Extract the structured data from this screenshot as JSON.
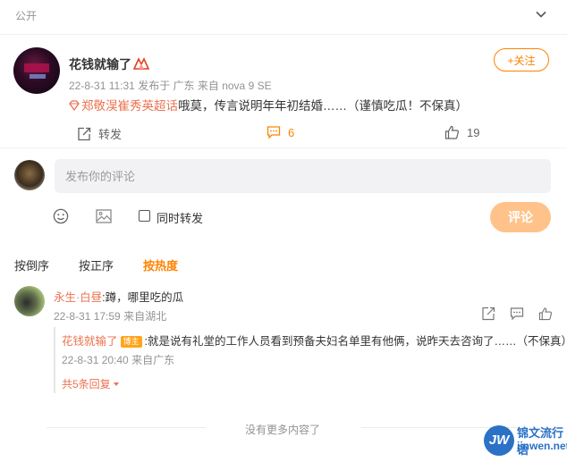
{
  "header": {
    "visibility": "公开"
  },
  "post": {
    "author": "花钱就输了",
    "time": "22-8-31 11:31",
    "location": "发布于 广东",
    "source": "来自 nova 9 SE",
    "follow_label": "+关注",
    "topic": "郑敬淏崔秀英超话",
    "body": "哦莫，传言说明年年初结婚……（谨慎吃瓜！不保真）",
    "repost_label": "转发",
    "comment_count": "6",
    "like_count": "19"
  },
  "composer": {
    "placeholder": "发布你的评论",
    "also_repost_label": "同时转发",
    "submit_label": "评论"
  },
  "sort": {
    "items": [
      "按倒序",
      "按正序",
      "按热度"
    ],
    "active": "按热度"
  },
  "comments": [
    {
      "user": "永生·白昼",
      "text": ":蹲，哪里吃的瓜",
      "time": "22-8-31 17:59",
      "location": "来自湖北",
      "replies": [
        {
          "user": "花钱就输了",
          "badge": "博主",
          "text": ":就是说有礼堂的工作人员看到预备夫妇名单里有他俩，说昨天去咨询了……（不保真）",
          "time": "22-8-31 20:40",
          "location": "来自广东"
        }
      ],
      "more_replies": "共5条回复"
    }
  ],
  "footer": {
    "end_text": "没有更多内容了"
  },
  "watermark": {
    "logo": "JW",
    "line1": "锦文流行语",
    "line2": "jinwen.net"
  },
  "colors": {
    "accent": "#ff8200",
    "link": "#eb7350",
    "muted": "#939393"
  }
}
